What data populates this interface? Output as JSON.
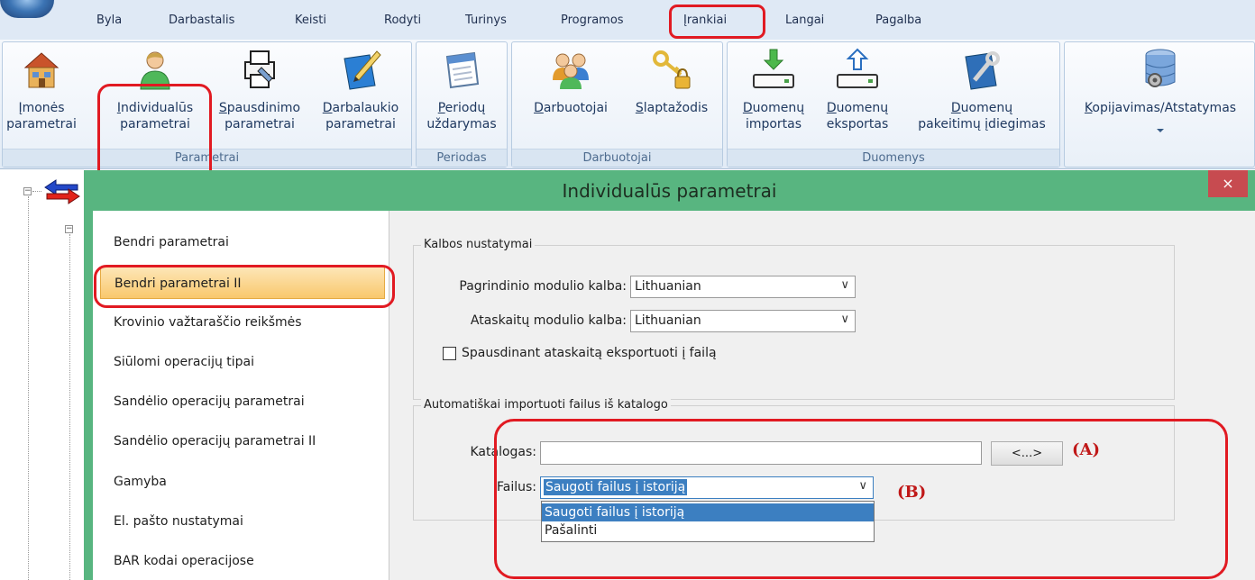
{
  "menu": {
    "items": [
      "Byla",
      "Darbastalis",
      "Keisti",
      "Rodyti",
      "Turinys",
      "Programos",
      "Įrankiai",
      "Langai",
      "Pagalba"
    ],
    "active": "Įrankiai"
  },
  "ribbon": {
    "groups": [
      {
        "label": "Parametrai",
        "buttons": [
          {
            "label": "Įmonės\nparametrai",
            "icon": "house-icon"
          },
          {
            "label": "Individualūs\nparametrai",
            "icon": "user-icon"
          },
          {
            "label": "Spausdinimo\nparametrai",
            "icon": "printer-settings-icon"
          },
          {
            "label": "Darbalaukio\nparametrai",
            "icon": "desk-pen-icon"
          }
        ]
      },
      {
        "label": "Periodas",
        "buttons": [
          {
            "label": "Periodų\nuždarymas",
            "icon": "calendar-icon"
          }
        ]
      },
      {
        "label": "Darbuotojai",
        "buttons": [
          {
            "label": "Darbuotojai",
            "icon": "users-icon"
          },
          {
            "label": "Slaptažodis",
            "icon": "key-lock-icon"
          }
        ]
      },
      {
        "label": "Duomenys",
        "buttons": [
          {
            "label": "Duomenų\nimportas",
            "icon": "import-icon"
          },
          {
            "label": "Duomenų\neksportas",
            "icon": "export-icon"
          },
          {
            "label": "Duomenų\npakeitimų įdiegimas",
            "icon": "wrench-icon"
          }
        ]
      },
      {
        "label": "",
        "buttons": [
          {
            "label": "Kopijavimas/Atstatymas",
            "icon": "database-gear-icon"
          }
        ]
      }
    ]
  },
  "dialog": {
    "title": "Individualūs parametrai",
    "close": "×",
    "nav": [
      "Bendri parametrai",
      "Bendri parametrai II",
      "Krovinio važtaraščio reikšmės",
      "Siūlomi operacijų tipai",
      "Sandėlio operacijų parametrai",
      "Sandėlio operacijų parametrai II",
      "Gamyba",
      "El. pašto nustatymai",
      "BAR kodai operacijose"
    ],
    "nav_selected": "Bendri parametrai II",
    "kalbos": {
      "legend": "Kalbos nustatymai",
      "main_label": "Pagrindinio modulio kalba:",
      "main_value": "Lithuanian",
      "reports_label": "Ataskaitų modulio kalba:",
      "reports_value": "Lithuanian",
      "export_checkbox_label": "Spausdinant ataskaitą eksportuoti į failą",
      "export_checked": false
    },
    "auto_import": {
      "legend": "Automatiškai importuoti failus iš katalogo",
      "catalog_label": "Katalogas:",
      "catalog_value": "",
      "browse_label": "<...>",
      "files_label": "Failus:",
      "files_value": "Saugoti failus į istoriją",
      "files_options": [
        "Saugoti failus į istoriją",
        "Pašalinti"
      ],
      "annot_a": "(A)",
      "annot_b": "(B)"
    }
  },
  "colors": {
    "highlight_red": "#e11a22",
    "dialog_green": "#58b580",
    "selection_blue": "#3c7fc1",
    "nav_selected_orange": "#f9c86d"
  }
}
